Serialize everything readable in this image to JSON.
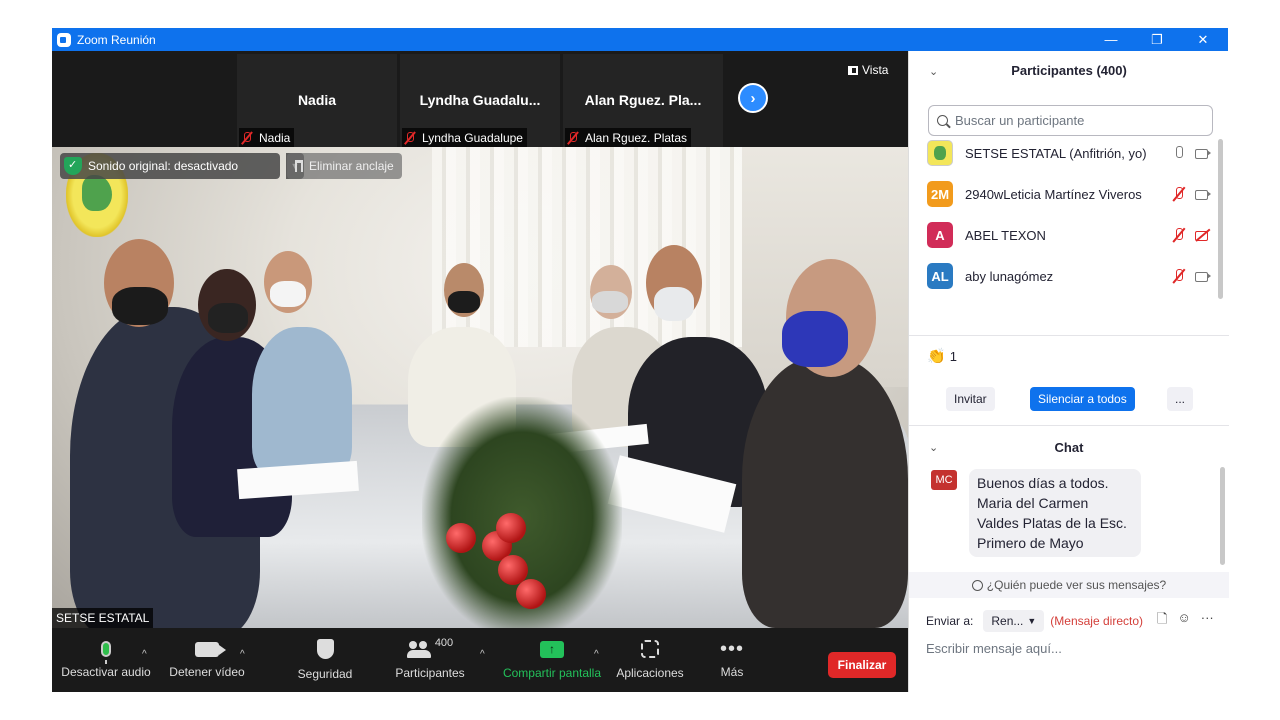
{
  "window": {
    "title": "Zoom Reunión"
  },
  "strip": {
    "tiles": [
      {
        "name": "Nadia",
        "label": "Nadia"
      },
      {
        "name": "Lyndha  Guadalu...",
        "label": "Lyndha Guadalupe"
      },
      {
        "name": "Alan  Rguez. Pla...",
        "label": "Alan  Rguez. Platas"
      }
    ],
    "view_label": "Vista"
  },
  "video": {
    "original_sound": "Sonido original: desactivado",
    "unpin": "Eliminar anclaje",
    "speaker": "SETSE ESTATAL"
  },
  "toolbar": {
    "audio": "Desactivar audio",
    "video": "Detener vídeo",
    "security": "Seguridad",
    "participants": "Participantes",
    "participants_count": "400",
    "share": "Compartir pantalla",
    "apps": "Aplicaciones",
    "more": "Más",
    "end": "Finalizar"
  },
  "panel": {
    "participants_title": "Participantes (400)",
    "search_placeholder": "Buscar un participante",
    "participants": [
      {
        "initials": "",
        "name": "SETSE ESTATAL (Anfitrión, yo)",
        "color": "#f3e65a",
        "mic": "on",
        "cam": "on"
      },
      {
        "initials": "2M",
        "name": "2940wLeticia Martínez Viveros",
        "color": "#f29b1d",
        "mic": "off",
        "cam": "on"
      },
      {
        "initials": "A",
        "name": "ABEL TEXON",
        "color": "#d12c58",
        "mic": "off",
        "cam": "off"
      },
      {
        "initials": "AL",
        "name": "aby lunagómez",
        "color": "#2a7ac2",
        "mic": "off",
        "cam": "on"
      }
    ],
    "reaction_count": "1",
    "invite": "Invitar",
    "mute_all": "Silenciar a todos",
    "more": "...",
    "chat_title": "Chat",
    "chat_message": {
      "initials": "MC",
      "text": "Buenos días a todos.\nMaria del Carmen\nValdes Platas de la Esc.\nPrimero de Mayo"
    },
    "who_can_see": "¿Quién puede ver sus mensajes?",
    "send_to_label": "Enviar a:",
    "send_to_value": "Ren...",
    "direct_message": "(Mensaje directo)",
    "input_placeholder": "Escribir mensaje aquí..."
  },
  "colors": {
    "zoom_blue": "#0e72ed",
    "end_red": "#e02828",
    "share_green": "#23c15a"
  }
}
